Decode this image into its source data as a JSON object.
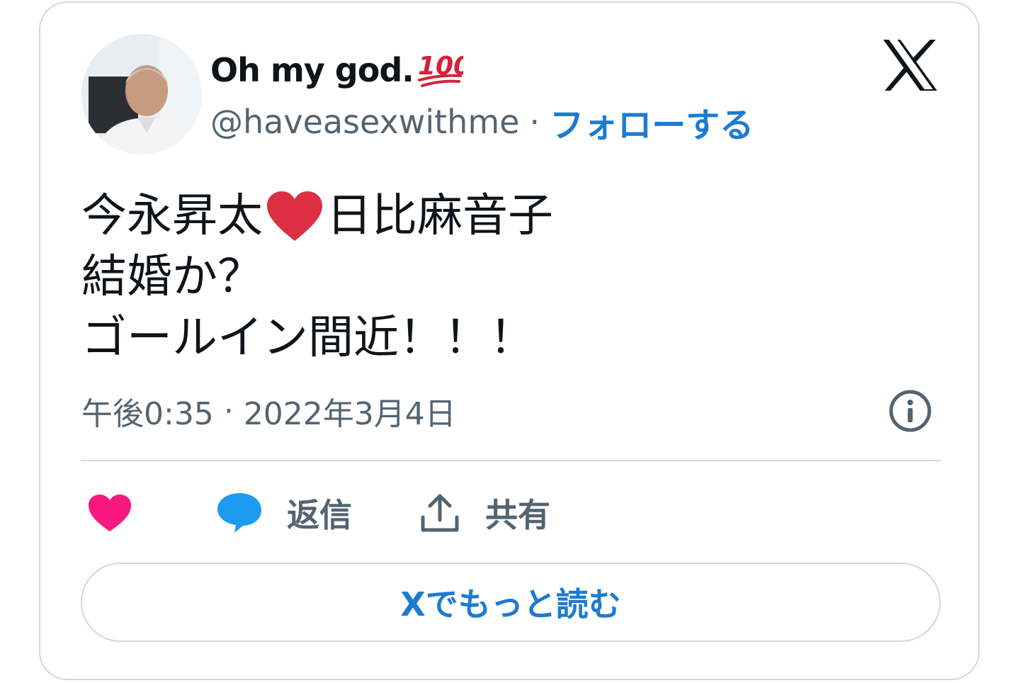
{
  "author": {
    "display_name": "Oh my god.",
    "name_emoji": "hundred-points-icon",
    "handle": "@haveasexwithme",
    "separator": "·",
    "follow_label": "フォローする"
  },
  "tweet": {
    "line1_before": "今永昇太",
    "line1_emoji": "red-heart-icon",
    "line1_after": "日比麻音子",
    "line2": "結婚か？",
    "line3": "ゴールイン間近！！！"
  },
  "meta": {
    "time": "午後0:35",
    "separator": "·",
    "date": "2022年3月4日"
  },
  "actions": {
    "like_icon": "heart-icon",
    "reply_icon": "speech-bubble-icon",
    "reply_label": "返信",
    "share_icon": "upload-icon",
    "share_label": "共有"
  },
  "read_more_label": "Xでもっと読む",
  "colors": {
    "text": "#0f1419",
    "secondary": "#536471",
    "link": "#1d7bd0",
    "like": "#f91880",
    "reply": "#1d9bf0",
    "border": "#cfd9de",
    "hundred": "#d6213b",
    "heart_emoji": "#dd2e44"
  }
}
